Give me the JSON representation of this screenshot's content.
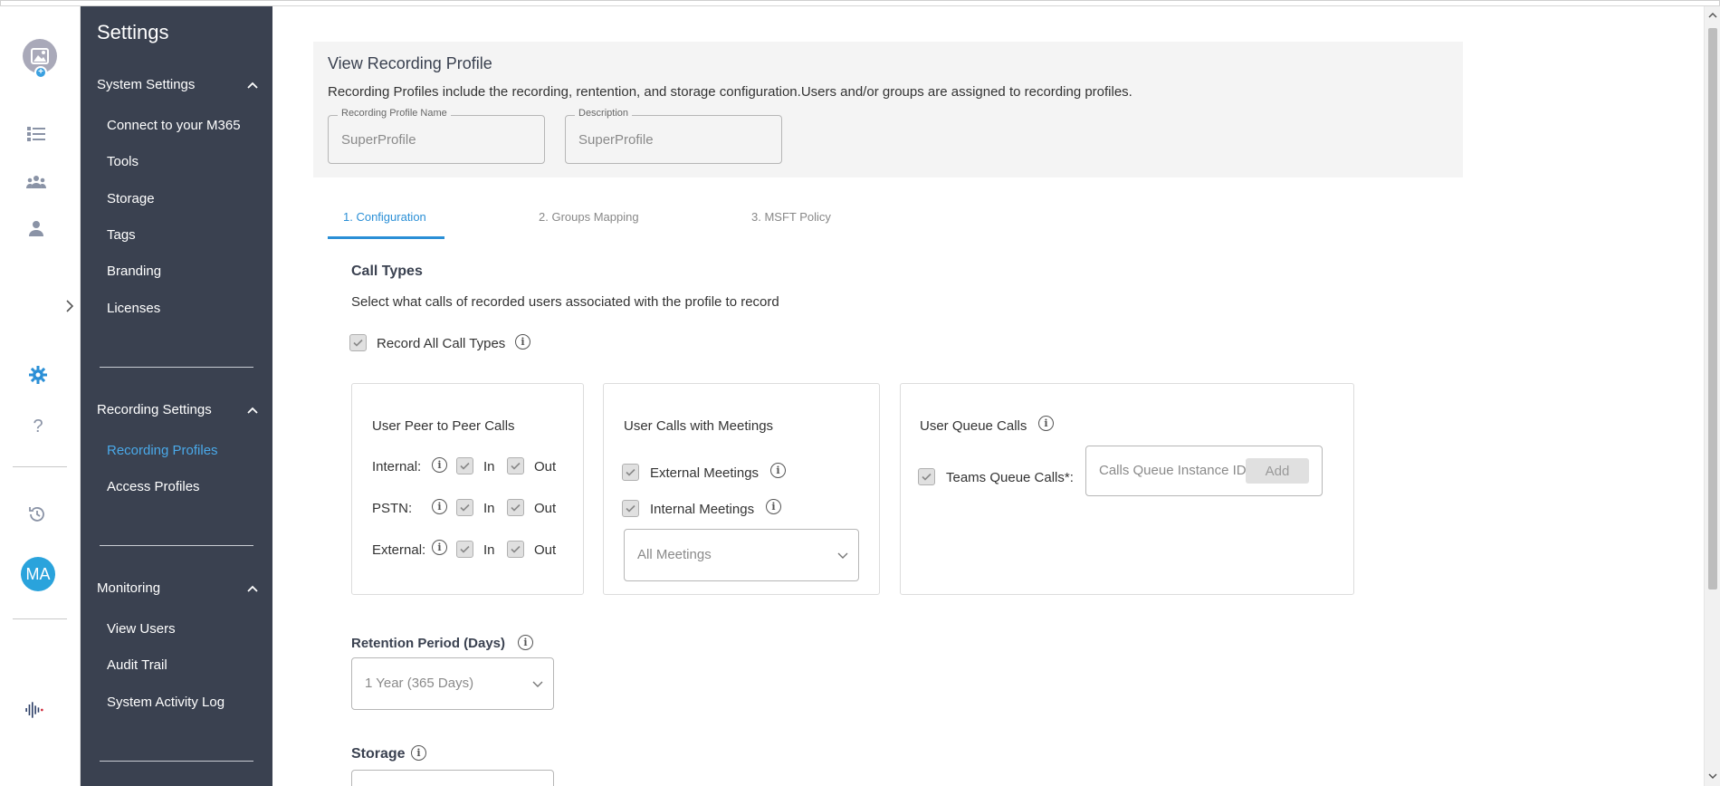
{
  "sidebar": {
    "title": "Settings",
    "sections": [
      {
        "label": "System Settings",
        "items": [
          "Connect to your M365",
          "Tools",
          "Storage",
          "Tags",
          "Branding",
          "Licenses"
        ]
      },
      {
        "label": "Recording Settings",
        "items": [
          "Recording Profiles",
          "Access Profiles"
        ]
      },
      {
        "label": "Monitoring",
        "items": [
          "View Users",
          "Audit Trail",
          "System Activity Log"
        ]
      }
    ],
    "active_item": "Recording Profiles"
  },
  "rail": {
    "user_initials": "MA"
  },
  "page": {
    "title": "View Recording Profile",
    "description": "Recording Profiles include the recording, rentention, and storage configuration.Users and/or groups are assigned to recording profiles.",
    "profile_name": {
      "label": "Recording Profile Name",
      "value": "SuperProfile"
    },
    "profile_description": {
      "label": "Description",
      "value": "SuperProfile"
    }
  },
  "tabs": [
    {
      "label": "1. Configuration",
      "active": true
    },
    {
      "label": "2. Groups Mapping",
      "active": false
    },
    {
      "label": "3. MSFT Policy",
      "active": false
    }
  ],
  "call_types": {
    "heading": "Call Types",
    "subtext": "Select what calls of recorded users associated with the profile to record",
    "record_all_label": "Record All Call Types",
    "peer_card": {
      "title": "User Peer to Peer Calls",
      "rows": [
        {
          "label": "Internal:",
          "in": "In",
          "out": "Out"
        },
        {
          "label": "PSTN:",
          "in": "In",
          "out": "Out"
        },
        {
          "label": "External:",
          "in": "In",
          "out": "Out"
        }
      ]
    },
    "meetings_card": {
      "title": "User Calls with Meetings",
      "external": "External Meetings",
      "internal": "Internal Meetings",
      "select_value": "All Meetings"
    },
    "queue_card": {
      "title": "User Queue Calls",
      "teams_label": "Teams Queue Calls*:",
      "input_placeholder": "Calls Queue Instance ID",
      "add_label": "Add"
    }
  },
  "retention": {
    "heading": "Retention Period (Days)",
    "value": "1 Year (365 Days)"
  },
  "storage": {
    "heading": "Storage"
  },
  "colors": {
    "sidebar_bg": "#3a4150",
    "accent": "#2a8fd6",
    "active_item": "#4aa9e9",
    "avatar": "#2aa3dc"
  }
}
